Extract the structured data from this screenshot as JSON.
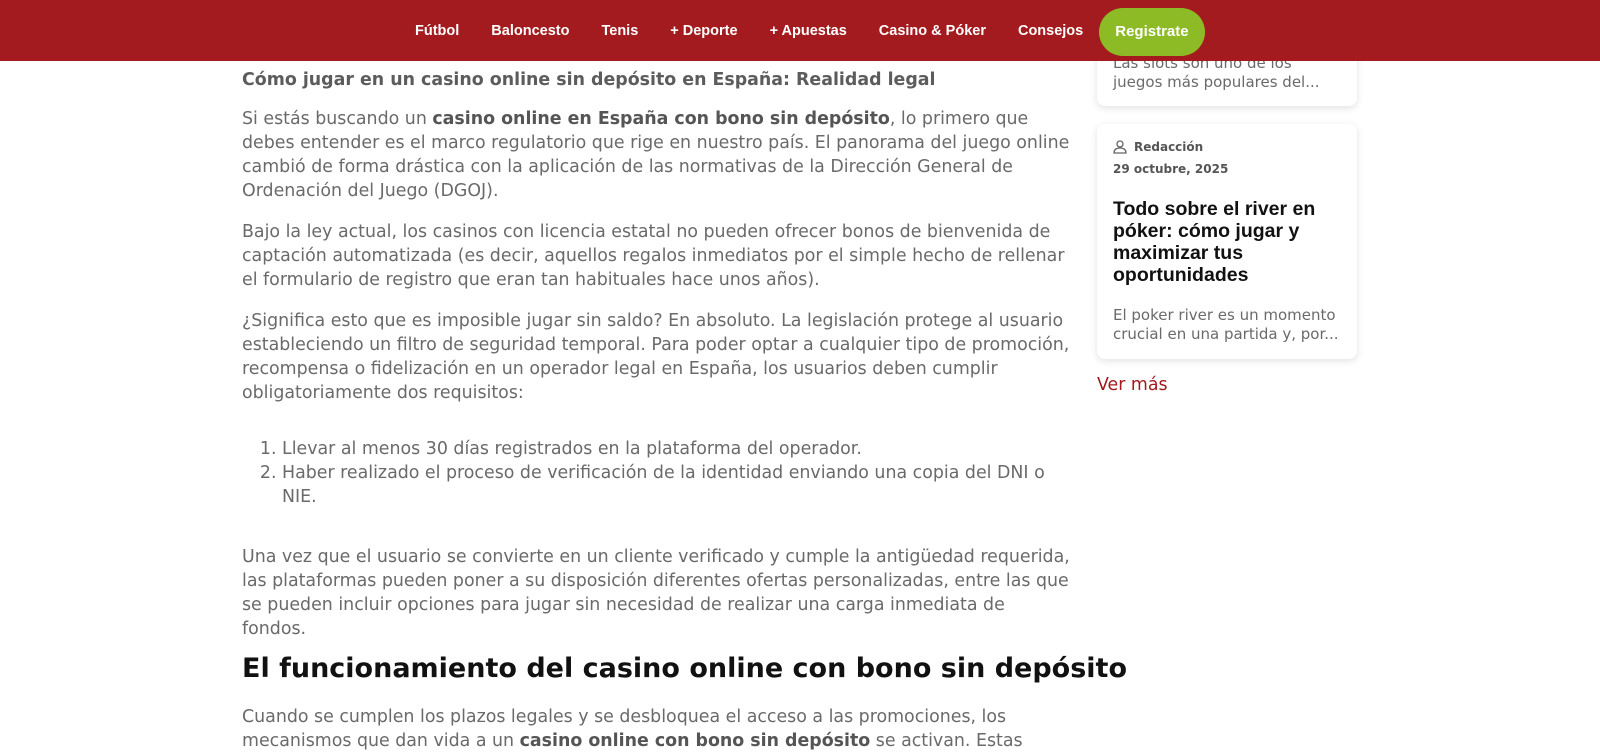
{
  "nav": {
    "items": [
      {
        "label": "Fútbol"
      },
      {
        "label": "Baloncesto"
      },
      {
        "label": "Tenis"
      },
      {
        "label": "+ Deporte"
      },
      {
        "label": "+ Apuestas"
      },
      {
        "label": "Casino & Póker"
      },
      {
        "label": "Consejos"
      }
    ],
    "register_label": "Registrate"
  },
  "article": {
    "subheading": "Cómo jugar en un casino online sin depósito en España: Realidad legal",
    "p1_before": "Si estás buscando un ",
    "p1_bold": "casino online en España con bono sin depósito",
    "p1_after": ", lo primero que debes entender es el marco regulatorio que rige en nuestro país. El panorama del juego online cambió de forma drástica con la aplicación de las normativas de la Dirección General de Ordenación del Juego (DGOJ).",
    "p2": "Bajo la ley actual, los casinos con licencia estatal no pueden ofrecer bonos de bienvenida de captación automatizada (es decir, aquellos regalos inmediatos por el simple hecho de rellenar el formulario de registro que eran tan habituales hace unos años).",
    "p3": "¿Significa esto que es imposible jugar sin saldo? En absoluto. La legislación protege al usuario estableciendo un filtro de seguridad temporal. Para poder optar a cualquier tipo de promoción, recompensa o fidelización en un operador legal en España, los usuarios deben cumplir obligatoriamente dos requisitos:",
    "list": [
      "Llevar al menos 30 días registrados en la plataforma del operador.",
      "Haber realizado el proceso de verificación de la identidad enviando una copia del DNI o NIE."
    ],
    "p4": "Una vez que el usuario se convierte en un cliente verificado y cumple la antigüedad requerida, las plataformas pueden poner a su disposición diferentes ofertas personalizadas, entre las que se pueden incluir opciones para jugar sin necesidad de realizar una carga inmediata de fondos.",
    "h2": "El funcionamiento del casino online con bono sin depósito",
    "p5_before": "Cuando se cumplen los plazos legales y se desbloquea el acceso a las promociones, los mecanismos que dan vida a un ",
    "p5_bold": "casino online con bono sin depósito",
    "p5_after": " se activan. Estas"
  },
  "sidebar": {
    "card1_excerpt": "Las slots son uno de los juegos más populares del...",
    "card2": {
      "author": "Redacción",
      "date": "29 octubre, 2025",
      "title": "Todo sobre el river en póker: cómo jugar y maximizar tus oportunidades",
      "excerpt": "El poker river es un momento crucial en una partida y, por..."
    },
    "see_more": "Ver más"
  },
  "colors": {
    "header_bg": "#a31b1e",
    "register_bg": "#8dbb26",
    "link": "#a31b1e"
  }
}
